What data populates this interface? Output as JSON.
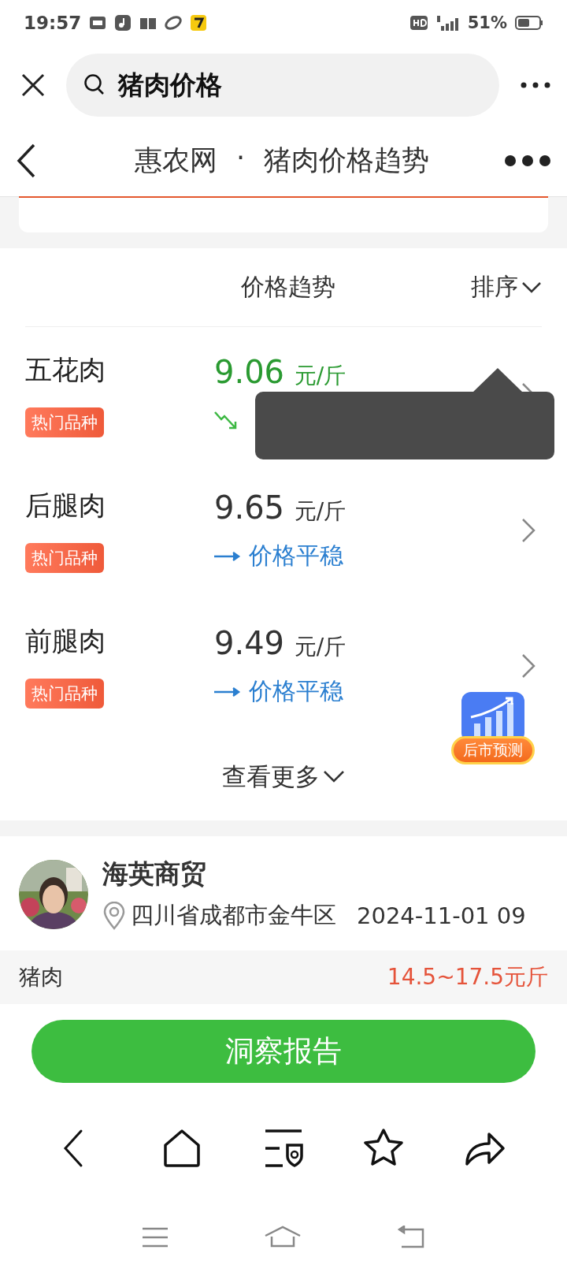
{
  "status_bar": {
    "time": "19:57",
    "battery": "51%"
  },
  "search_bar": {
    "query": "猪肉价格"
  },
  "nav": {
    "site": "惠农网",
    "separator": "·",
    "page": "猪肉价格趋势"
  },
  "price_list": {
    "column": "价格趋势",
    "sort": "排序",
    "items": [
      {
        "name": "五花肉",
        "badge": "热门品种",
        "price": "9.06",
        "unit": "元/斤",
        "kind": "down"
      },
      {
        "name": "后腿肉",
        "badge": "热门品种",
        "price": "9.65",
        "unit": "元/斤",
        "kind": "flat",
        "trend_text": "价格平稳"
      },
      {
        "name": "前腿肉",
        "badge": "热门品种",
        "price": "9.49",
        "unit": "元/斤",
        "kind": "flat",
        "trend_text": "价格平稳"
      }
    ],
    "more": "查看更多"
  },
  "forecast_badge": {
    "label": "后市预测"
  },
  "merchant": {
    "name": "海英商贸",
    "location": "四川省成都市金牛区",
    "datetime": "2024-11-01 09",
    "product": "猪肉",
    "price": "14.5~17.5元斤"
  },
  "report_button": {
    "label": "洞察报告"
  }
}
